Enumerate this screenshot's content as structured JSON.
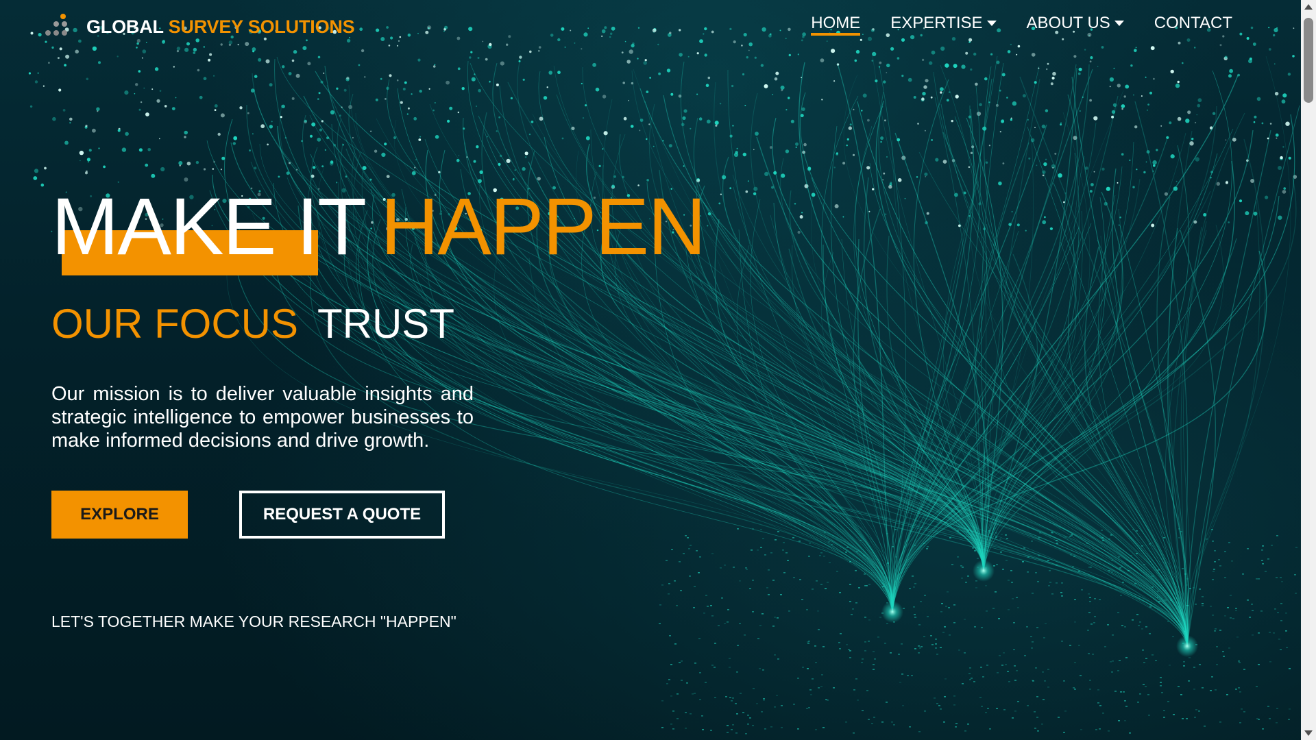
{
  "brand": {
    "name_part1": "GLOBAL",
    "name_part2": "SURVEY SOLUTIONS",
    "accent_color": "#f39200"
  },
  "nav": {
    "items": [
      {
        "label": "HOME",
        "active": true,
        "has_dropdown": false
      },
      {
        "label": "EXPERTISE",
        "active": false,
        "has_dropdown": true
      },
      {
        "label": "ABOUT US",
        "active": false,
        "has_dropdown": true
      },
      {
        "label": "CONTACT",
        "active": false,
        "has_dropdown": false
      }
    ]
  },
  "hero": {
    "title_white": "MAKE IT",
    "title_orange": "HAPPEN",
    "focus_label": "OUR FOCUS",
    "focus_value": "TRUST",
    "mission": "Our mission is to deliver valuable insights and strategic intelligence to empower businesses to make informed decisions and drive growth.",
    "explore_label": "EXPLORE",
    "quote_label": "REQUEST A QUOTE",
    "tagline": "LET'S TOGETHER MAKE YOUR RESEARCH \"HAPPEN\""
  },
  "colors": {
    "background": "#031e26",
    "accent": "#f39200",
    "glow": "#1fd6c0"
  }
}
